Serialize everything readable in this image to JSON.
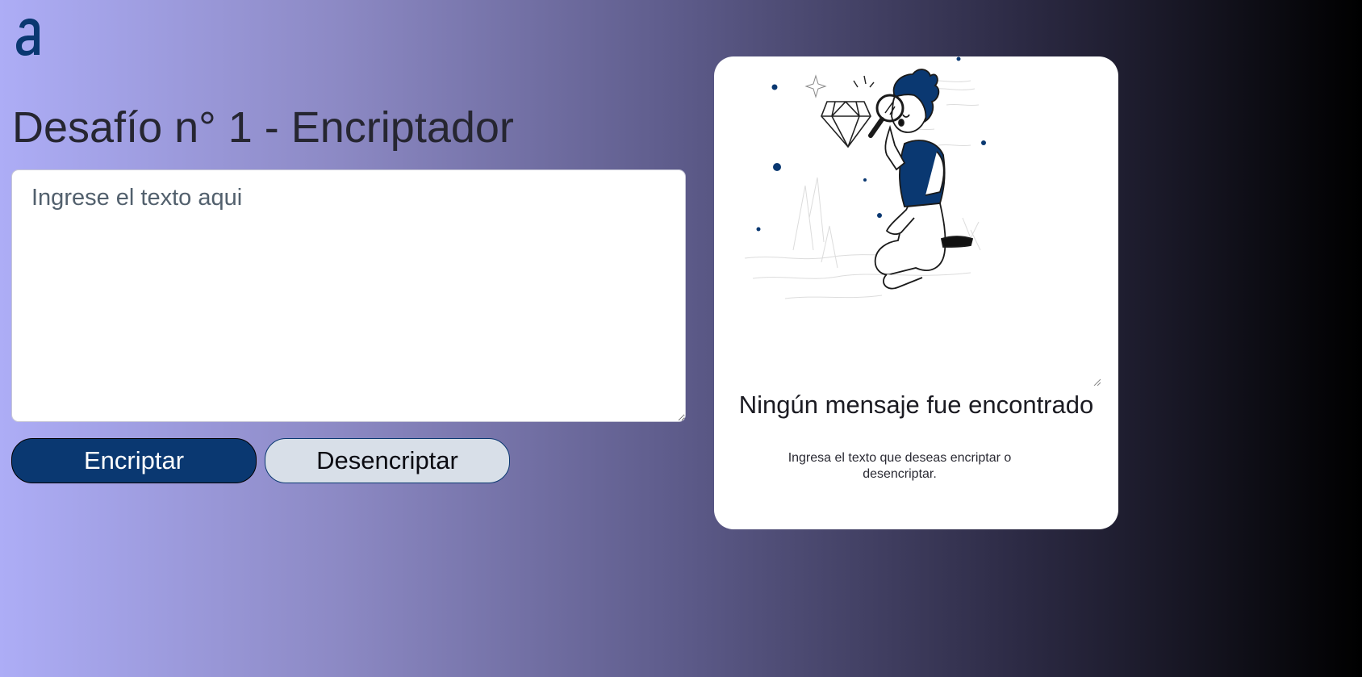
{
  "logo": {
    "glyph": "a",
    "icon": "alura-logo-icon",
    "color": "#0a3871"
  },
  "title": "Desafío n° 1 - Encriptador",
  "input": {
    "placeholder": "Ingrese el texto aqui",
    "value": ""
  },
  "buttons": {
    "encrypt_label": "Encriptar",
    "decrypt_label": "Desencriptar"
  },
  "output": {
    "illustration_icon": "person-magnifier-illustration",
    "title": "Ningún mensaje fue encontrado",
    "message": "Ingresa el texto que deseas encriptar o desencriptar."
  },
  "colors": {
    "accent": "#0a3871",
    "button_secondary": "#d8dfe8",
    "card_background": "#ffffff"
  }
}
